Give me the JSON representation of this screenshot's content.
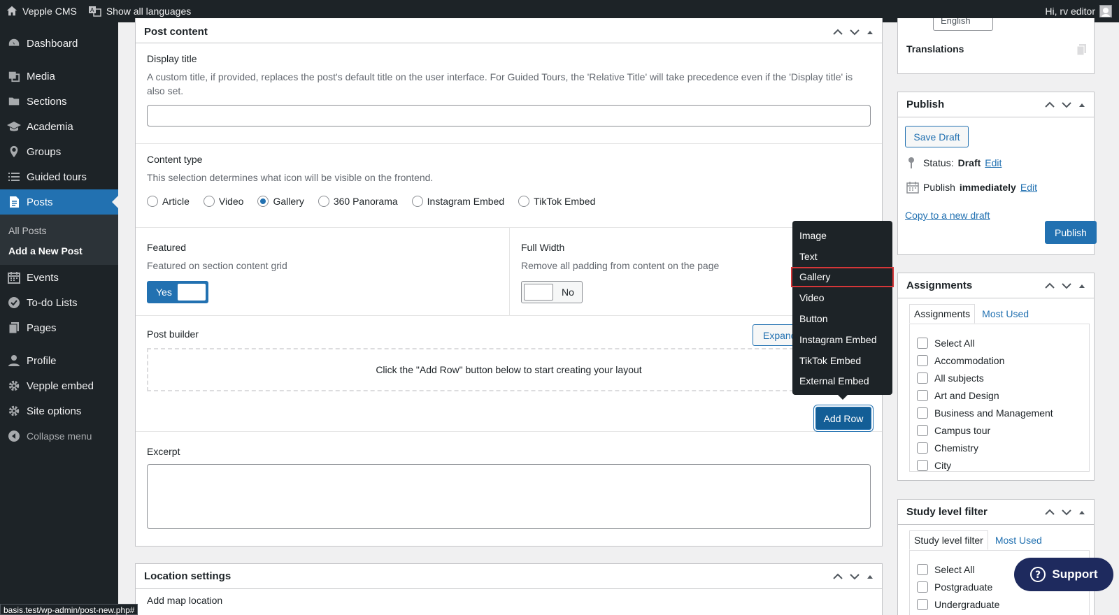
{
  "adminbar": {
    "site_name": "Vepple CMS",
    "languages": "Show all languages",
    "greeting": "Hi, rv editor"
  },
  "sidebar": {
    "items": [
      {
        "label": "Dashboard",
        "icon": "dashboard-icon"
      },
      {
        "label": "Media",
        "icon": "media-icon"
      },
      {
        "label": "Sections",
        "icon": "folder-icon"
      },
      {
        "label": "Academia",
        "icon": "graduation-cap-icon"
      },
      {
        "label": "Groups",
        "icon": "location-pin-icon"
      },
      {
        "label": "Guided tours",
        "icon": "list-icon"
      },
      {
        "label": "Posts",
        "icon": "posts-icon"
      },
      {
        "label": "Events",
        "icon": "calendar-icon"
      },
      {
        "label": "To-do Lists",
        "icon": "check-circle-icon"
      },
      {
        "label": "Pages",
        "icon": "pages-icon"
      },
      {
        "label": "Profile",
        "icon": "user-icon"
      },
      {
        "label": "Vepple embed",
        "icon": "gear-icon"
      },
      {
        "label": "Site options",
        "icon": "gear-icon"
      }
    ],
    "posts_submenu": [
      "All Posts",
      "Add a New Post"
    ],
    "collapse": "Collapse menu"
  },
  "post_content": {
    "title": "Post content",
    "display_title": {
      "label": "Display title",
      "desc": "A custom title, if provided, replaces the post's default title on the user interface. For Guided Tours, the 'Relative Title' will take precedence even if the 'Display title' is also set.",
      "value": ""
    },
    "content_type": {
      "label": "Content type",
      "desc": "This selection determines what icon will be visible on the frontend.",
      "options": [
        "Article",
        "Video",
        "Gallery",
        "360 Panorama",
        "Instagram Embed",
        "TikTok Embed"
      ],
      "selected": "Gallery"
    },
    "featured": {
      "label": "Featured",
      "desc": "Featured on section content grid",
      "value": "Yes"
    },
    "full_width": {
      "label": "Full Width",
      "desc": "Remove all padding from content on the page",
      "value": "No"
    },
    "post_builder": {
      "label": "Post builder",
      "expand": "Expand",
      "empty": "Click the \"Add Row\" button below to start creating your layout",
      "add_row": "Add Row"
    },
    "excerpt": {
      "label": "Excerpt",
      "value": ""
    }
  },
  "dropdown": {
    "items": [
      "Image",
      "Text",
      "Gallery",
      "Video",
      "Button",
      "Instagram Embed",
      "TikTok Embed",
      "External Embed"
    ],
    "highlighted": "Gallery"
  },
  "location_settings": {
    "title": "Location settings",
    "add_map": "Add map location"
  },
  "translations": {
    "language": "English",
    "label": "Translations"
  },
  "publish": {
    "title": "Publish",
    "save_draft": "Save Draft",
    "status_label": "Status:",
    "status_value": "Draft",
    "edit": "Edit",
    "publish_label": "Publish",
    "publish_value": "immediately",
    "copy_draft": "Copy to a new draft",
    "publish_button": "Publish"
  },
  "assignments": {
    "title": "Assignments",
    "tab_all": "Assignments",
    "tab_most_used": "Most Used",
    "items": [
      "Select All",
      "Accommodation",
      "All subjects",
      "Art and Design",
      "Business and Management",
      "Campus tour",
      "Chemistry",
      "City"
    ]
  },
  "study_level": {
    "title": "Study level filter",
    "tab_all": "Study level filter",
    "tab_most_used": "Most Used",
    "items": [
      "Select All",
      "Postgraduate",
      "Undergraduate"
    ]
  },
  "support": {
    "label": "Support"
  },
  "statusbar": {
    "url": "basis.test/wp-admin/post-new.php#"
  },
  "colors": {
    "accent": "#2271b1",
    "sidebar": "#1d2327",
    "highlight": "#d63638",
    "support": "#1e2a5e"
  }
}
